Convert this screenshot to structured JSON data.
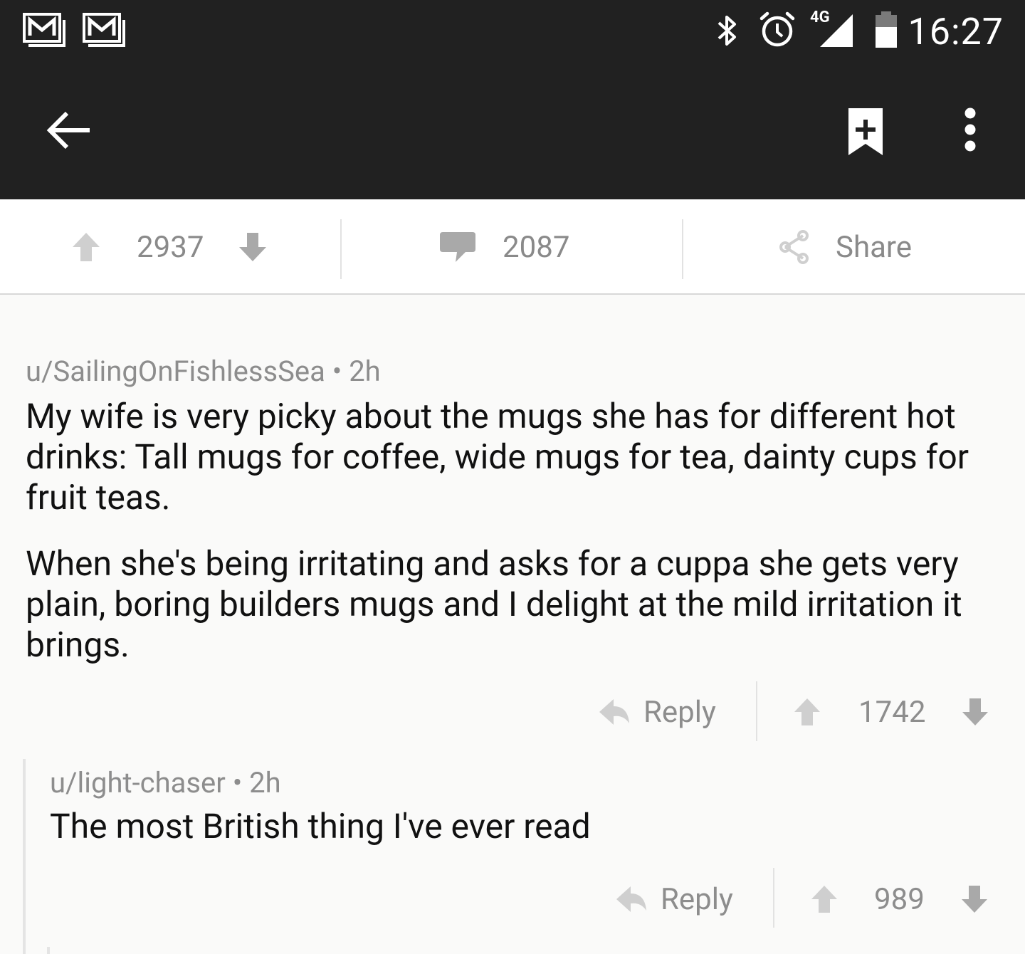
{
  "status_bar": {
    "time": "16:27",
    "network": "4G",
    "icons": [
      "gmail-icon",
      "gmail-icon",
      "bluetooth-icon",
      "alarm-icon",
      "signal-icon",
      "battery-icon"
    ]
  },
  "app_bar": {
    "icons": [
      "back-arrow-icon",
      "bookmark-add-icon",
      "more-vert-icon"
    ]
  },
  "post_actions": {
    "score": "2937",
    "comments": "2087",
    "share_label": "Share"
  },
  "comments": [
    {
      "author": "u/SailingOnFishlessSea",
      "age": "2h",
      "paragraphs": [
        "My wife is very picky about the mugs she has for different hot drinks: Tall mugs for coffee, wide mugs for tea, dainty cups for fruit teas.",
        "When she's being irritating and asks for a cuppa she gets very plain, boring builders mugs and I delight at the mild irritation it brings."
      ],
      "reply_label": "Reply",
      "score": "1742"
    },
    {
      "author": "u/light-chaser",
      "age": "2h",
      "paragraphs": [
        "The most British thing I've ever read"
      ],
      "reply_label": "Reply",
      "score": "989"
    }
  ],
  "separator": "•",
  "colors": {
    "bar_dark": "#212121",
    "background": "#fafaf9",
    "muted": "#8d8d8d",
    "text": "#111111"
  }
}
